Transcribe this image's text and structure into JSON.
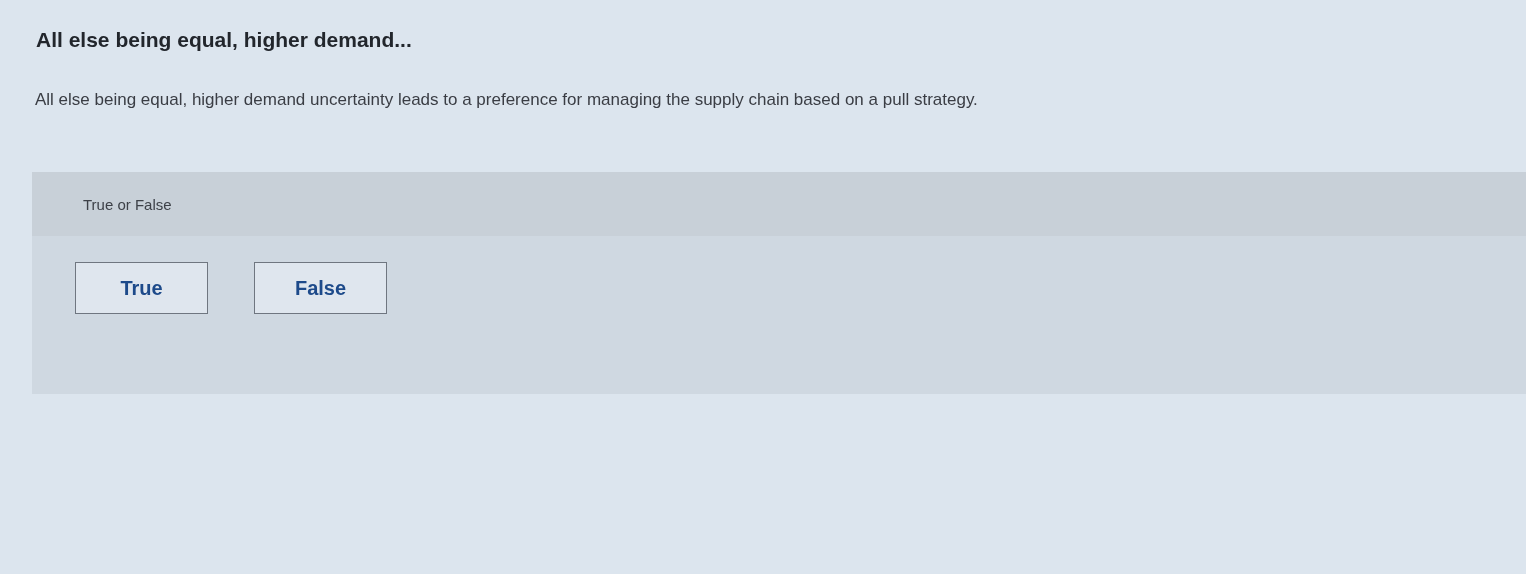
{
  "question": {
    "title": "All else being equal, higher demand...",
    "text": "All else being equal, higher demand uncertainty leads to a preference for managing the supply chain based on a pull strategy."
  },
  "answer_panel": {
    "type_label": "True or False",
    "options": [
      {
        "label": "True",
        "selected": false
      },
      {
        "label": "False",
        "selected": false
      }
    ]
  }
}
